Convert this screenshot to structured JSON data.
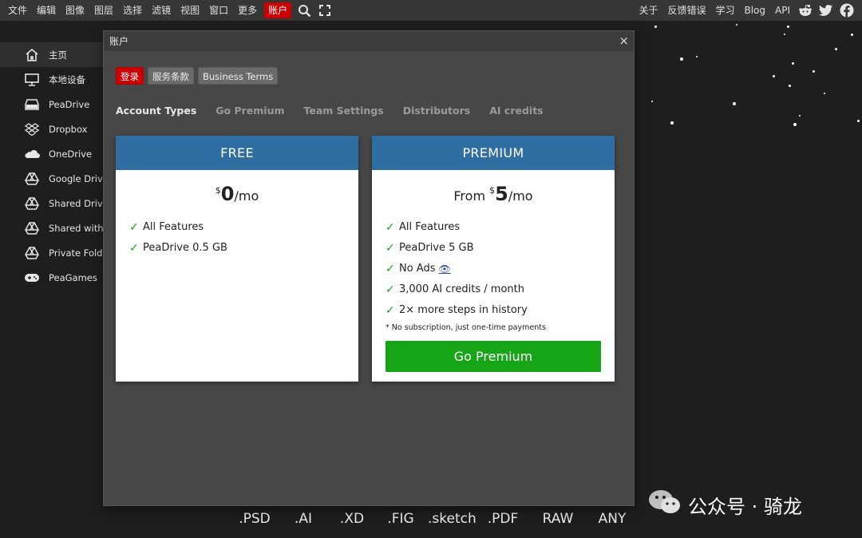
{
  "menubar": {
    "left": [
      "文件",
      "编辑",
      "图像",
      "图层",
      "选择",
      "滤镜",
      "视图",
      "窗口",
      "更多"
    ],
    "account": "账户",
    "right": [
      "关于",
      "反馈错误",
      "学习",
      "Blog",
      "API"
    ],
    "icons": [
      "search-icon",
      "fullscreen-icon",
      "reddit-icon",
      "twitter-icon",
      "facebook-icon"
    ]
  },
  "sidebar": {
    "items": [
      {
        "label": "主页",
        "icon": "home-icon"
      },
      {
        "label": "本地设备",
        "icon": "monitor-icon"
      },
      {
        "label": "PeaDrive",
        "icon": "drive-icon"
      },
      {
        "label": "Dropbox",
        "icon": "dropbox-icon"
      },
      {
        "label": "OneDrive",
        "icon": "cloud-icon"
      },
      {
        "label": "Google Drive",
        "icon": "google-drive-icon"
      },
      {
        "label": "Shared Drive",
        "icon": "google-drive-icon"
      },
      {
        "label": "Shared with me",
        "icon": "google-drive-icon"
      },
      {
        "label": "Private Folder",
        "icon": "google-drive-icon"
      },
      {
        "label": "PeaGames",
        "icon": "gamepad-icon"
      }
    ]
  },
  "formats": [
    ".PSD",
    ".AI",
    ".XD",
    ".FIG",
    ".sketch",
    ".PDF",
    "RAW",
    "ANY"
  ],
  "watermark": "公众号 · 骑龙",
  "dialog": {
    "title": "账户",
    "close": "×",
    "buttons": {
      "login": "登录",
      "terms": "服务条款",
      "business": "Business Terms"
    },
    "tabs": [
      "Account Types",
      "Go Premium",
      "Team Settings",
      "Distributors",
      "AI credits"
    ],
    "free": {
      "name": "FREE",
      "currency": "$",
      "amount": "0",
      "period": "/mo",
      "features": [
        "All Features",
        "PeaDrive 0.5 GB"
      ]
    },
    "premium": {
      "name": "PREMIUM",
      "prefix": "From ",
      "currency": "$",
      "amount": "5",
      "period": "/mo",
      "features": [
        "All Features",
        "PeaDrive 5 GB",
        "No Ads",
        "3,000 AI credits / month",
        "2× more steps in history"
      ],
      "eye": "👁",
      "note": "* No subscription, just one-time payments",
      "button": "Go Premium"
    }
  },
  "colors": {
    "accent_red": "#cc0000",
    "card_header": "#2f6ea3",
    "go_green": "#16a516",
    "check_green": "#19a319"
  }
}
